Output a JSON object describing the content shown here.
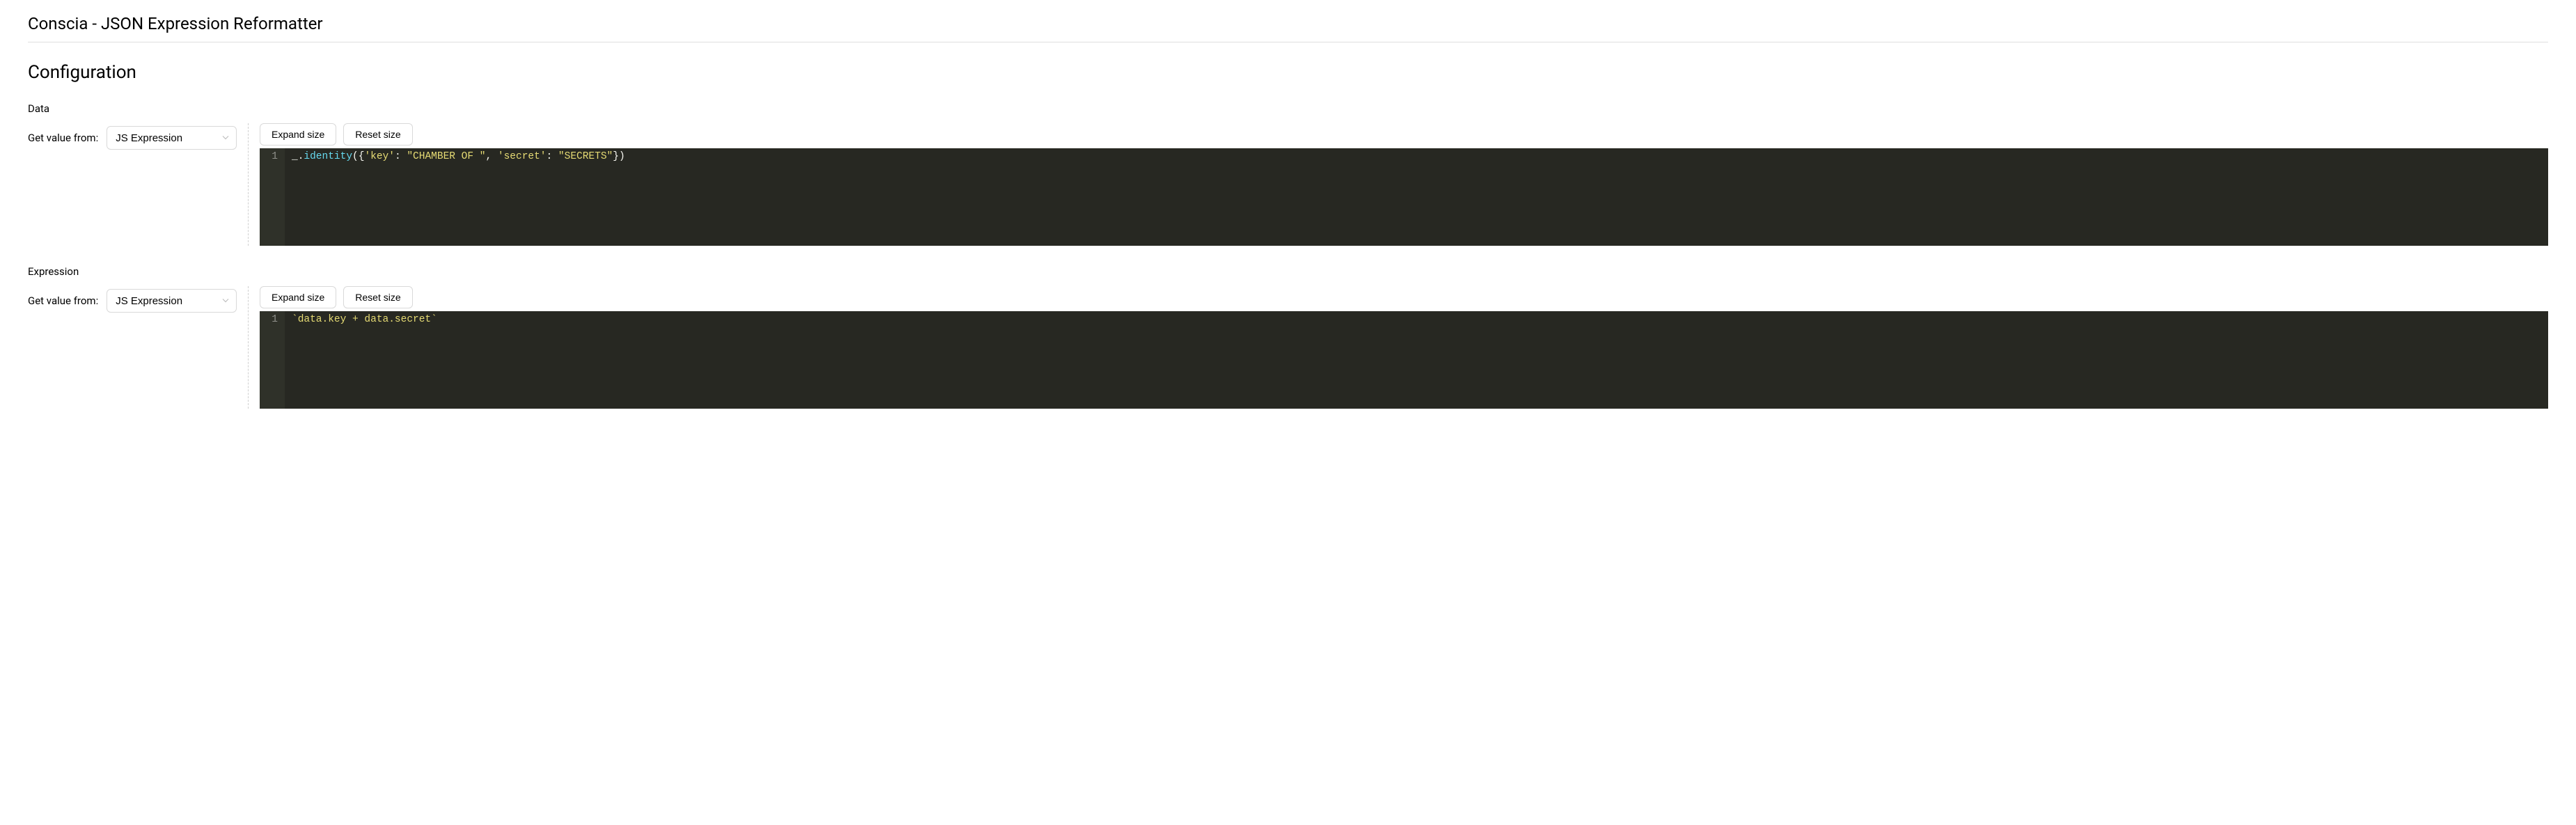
{
  "header": {
    "title": "Conscia - JSON Expression Reformatter"
  },
  "configuration": {
    "title": "Configuration",
    "get_value_label": "Get value from:",
    "expand_label": "Expand size",
    "reset_label": "Reset size",
    "fields": {
      "data": {
        "label": "Data",
        "select_value": "JS Expression",
        "code": {
          "line_number": "1",
          "t_id1": "_",
          "t_dot1": ".",
          "t_fn": "identity",
          "t_open": "({",
          "t_k1": "'key'",
          "t_colon1": ": ",
          "t_v1": "\"CHAMBER OF \"",
          "t_comma": ", ",
          "t_k2": "'secret'",
          "t_colon2": ": ",
          "t_v2": "\"SECRETS\"",
          "t_close": "})"
        }
      },
      "expression": {
        "label": "Expression",
        "select_value": "JS Expression",
        "code": {
          "line_number": "1",
          "t_full": "`data.key + data.secret`"
        }
      }
    }
  }
}
